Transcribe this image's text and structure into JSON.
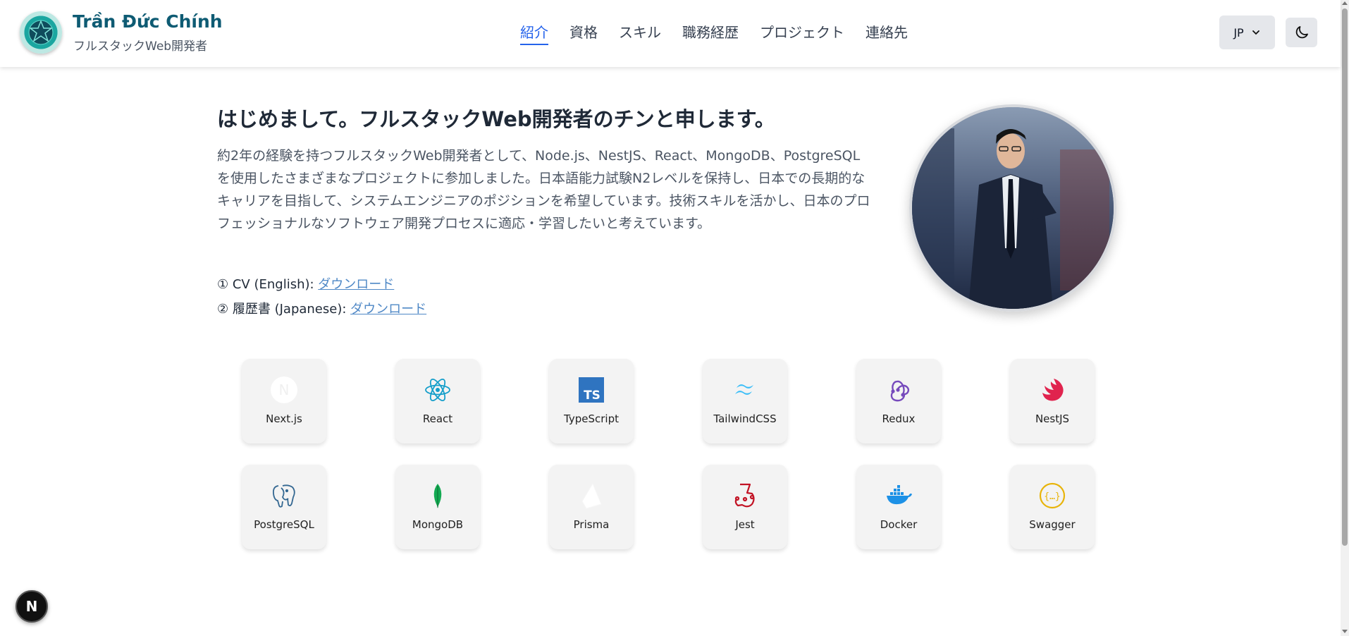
{
  "brand": {
    "name": "Trần Đức Chính",
    "subtitle": "フルスタックWeb開発者"
  },
  "nav": [
    {
      "label": "紹介",
      "active": true
    },
    {
      "label": "資格"
    },
    {
      "label": "スキル"
    },
    {
      "label": "職務経歴"
    },
    {
      "label": "プロジェクト"
    },
    {
      "label": "連絡先"
    }
  ],
  "lang": {
    "label": "JP"
  },
  "hero": {
    "headline": "はじめまして。フルスタックWeb開発者のチンと申します。",
    "intro": "約2年の経験を持つフルスタックWeb開発者として、Node.js、NestJS、React、MongoDB、PostgreSQLを使用したさまざまなプロジェクトに参加しました。日本語能力試験N2レベルを保持し、日本での長期的なキャリアを目指して、システムエンジニアのポジションを希望しています。技術スキルを活かし、日本のプロフェッショナルなソフトウェア開発プロセスに適応・学習したいと考えています。",
    "cv": [
      {
        "prefix": "① CV (English): ",
        "link": "ダウンロード"
      },
      {
        "prefix": "② 履歴書 (Japanese): ",
        "link": "ダウンロード"
      }
    ]
  },
  "tech": [
    {
      "label": "Next.js",
      "icon": "nextjs-icon"
    },
    {
      "label": "React",
      "icon": "react-icon"
    },
    {
      "label": "TypeScript",
      "icon": "typescript-icon"
    },
    {
      "label": "TailwindCSS",
      "icon": "tailwind-icon"
    },
    {
      "label": "Redux",
      "icon": "redux-icon"
    },
    {
      "label": "NestJS",
      "icon": "nestjs-icon"
    },
    {
      "label": "PostgreSQL",
      "icon": "postgresql-icon"
    },
    {
      "label": "MongoDB",
      "icon": "mongodb-icon"
    },
    {
      "label": "Prisma",
      "icon": "prisma-icon"
    },
    {
      "label": "Jest",
      "icon": "jest-icon"
    },
    {
      "label": "Docker",
      "icon": "docker-icon"
    },
    {
      "label": "Swagger",
      "icon": "swagger-icon"
    }
  ],
  "fab": {
    "label": "N"
  },
  "colors": {
    "accent": "#2563eb",
    "brand": "#0e5b73",
    "link": "#4f88c6"
  }
}
